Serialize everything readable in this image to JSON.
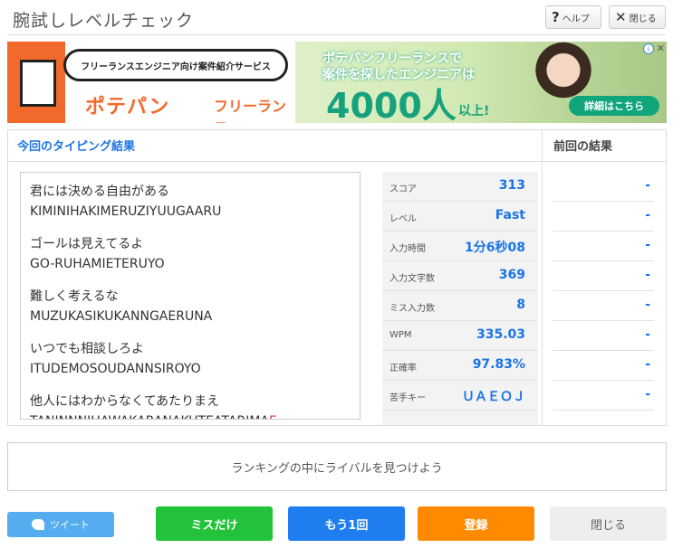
{
  "header": {
    "title": "腕試しレベルチェック",
    "help_label": "ヘルプ",
    "close_label": "閉じる"
  },
  "ad": {
    "bubble_text": "フリーランスエンジニア向け案件紹介サービス",
    "brand": "ポテパン",
    "brand_sub": "フリーランス",
    "line1": "ポテパンフリーランスで",
    "line2": "案件を探したエンジニアは",
    "big_number": "4000人",
    "suffix": "以上!",
    "cta": "詳細はこちら",
    "brand_color": "#f26a2b",
    "accent_color": "#16a27c"
  },
  "results": {
    "heading": "今回のタイピング結果",
    "previous_heading": "前回の結果",
    "phrases": [
      {
        "jp": "君には決める自由がある",
        "romaji": "KIMINIHAKIMERUZIYUUGAARU",
        "missed": ""
      },
      {
        "jp": "ゴールは見えてるよ",
        "romaji": "GO-RUHAMIETERUYO",
        "missed": ""
      },
      {
        "jp": "難しく考えるな",
        "romaji": "MUZUKASIKUKANNGAERUNA",
        "missed": ""
      },
      {
        "jp": "いつでも相談しろよ",
        "romaji": "ITUDEMOSOUDANNSIROYO",
        "missed": ""
      },
      {
        "jp": "他人にはわからなくてあたりまえ",
        "romaji": "TANINNNIHAWAKARANAKUTEATARIMA",
        "missed": "E"
      }
    ],
    "stats": [
      {
        "label": "スコア",
        "value": "313",
        "previous": "-"
      },
      {
        "label": "レベル",
        "value": "Fast",
        "previous": "-"
      },
      {
        "label": "入力時間",
        "value": "1分6秒08",
        "previous": "-"
      },
      {
        "label": "入力文字数",
        "value": "369",
        "previous": "-"
      },
      {
        "label": "ミス入力数",
        "value": "8",
        "previous": "-"
      },
      {
        "label": "WPM",
        "value": "335.03",
        "previous": "-"
      },
      {
        "label": "正確率",
        "value": "97.83%",
        "previous": "-"
      },
      {
        "label": "苦手キー",
        "value": "ＵＡＥＯＪ",
        "previous": "-"
      }
    ]
  },
  "ranking_text": "ランキングの中にライバルを見つけよう",
  "buttons": {
    "tweet": "ツイート",
    "miss_only": "ミスだけ",
    "again": "もう1回",
    "register": "登録",
    "close": "閉じる"
  },
  "colors": {
    "link_blue": "#1a73e8",
    "tweet": "#55acee",
    "miss_only": "#22c33a",
    "again": "#1e7ef0",
    "register": "#ff8a00",
    "miss_char": "#e53935"
  }
}
